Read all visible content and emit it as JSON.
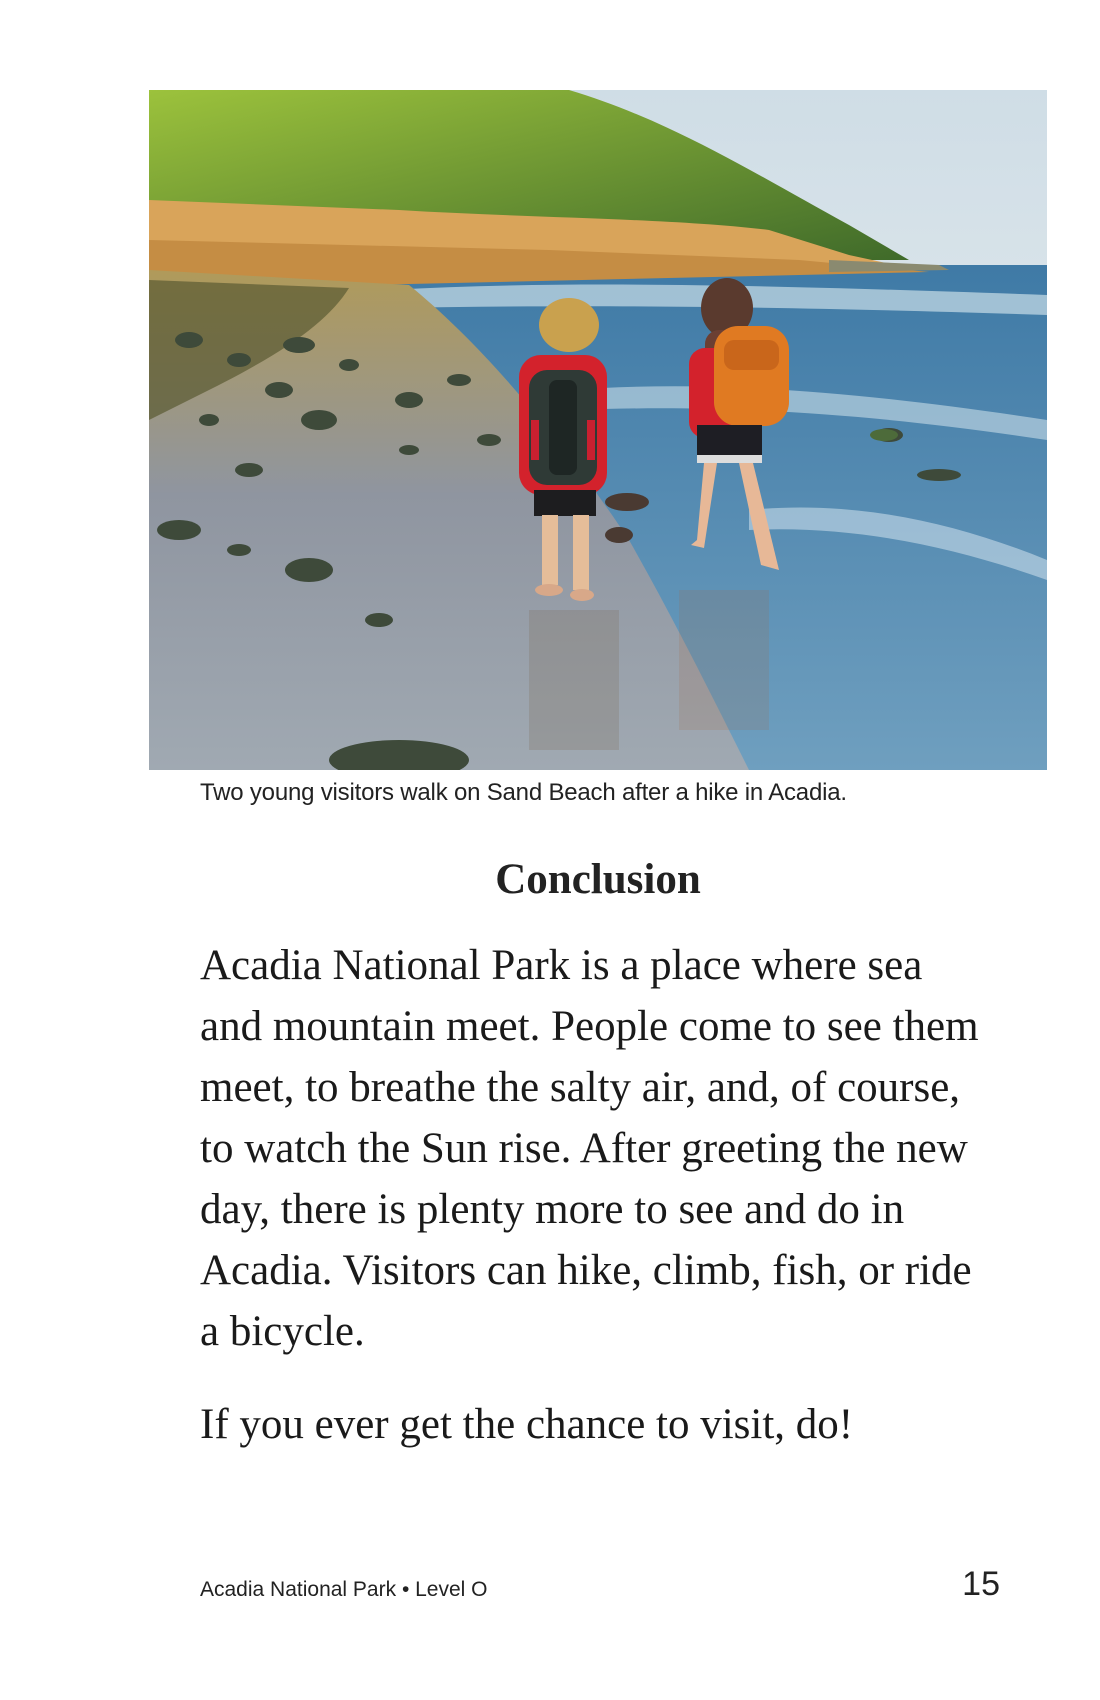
{
  "photo": {
    "alt": "Two young visitors walk on Sand Beach after a hike in Acadia.",
    "colors": {
      "sky": "#dfe8ee",
      "forest": "#6f9a2e",
      "cliff": "#d9a45a",
      "sea": "#4f86ad",
      "sand": "#9a9684",
      "jacket": "#d3222c",
      "backpack_orange": "#e07a22"
    }
  },
  "caption": "Two young visitors walk on Sand Beach after a hike in Acadia.",
  "heading": "Conclusion",
  "paragraphs": [
    "Acadia National Park is a place where sea and mountain meet. People come to see them meet, to breathe the salty air, and, of course, to watch the Sun rise. After greeting the new day, there is plenty more to see and do in Acadia. Visitors can hike, climb, fish, or ride a bicycle.",
    "If you ever get the chance to visit, do!"
  ],
  "footer": {
    "book_title": "Acadia National Park • Level O",
    "page_number": "15"
  }
}
